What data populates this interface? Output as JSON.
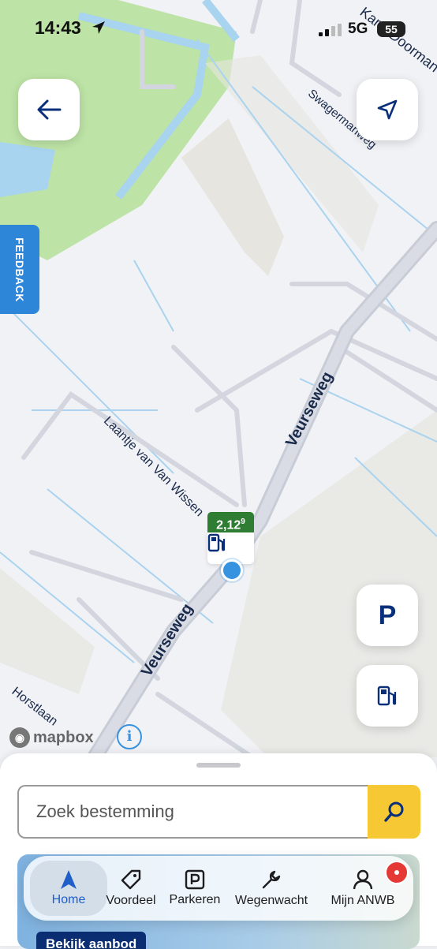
{
  "status_bar": {
    "time": "14:43",
    "network": "5G",
    "battery": "55"
  },
  "map": {
    "streets": [
      "Veurseweg",
      "Veurseweg",
      "Laantje van Van Wissen",
      "Swagermanweg",
      "Karel Doorman",
      "Horstlaan"
    ],
    "fuel_price": {
      "main": "2,12",
      "decimal": "9"
    },
    "attribution": "mapbox",
    "feedback_label": "FEEDBACK"
  },
  "search": {
    "placeholder": "Zoek bestemming"
  },
  "promo": {
    "button_label": "Bekijk aanbod"
  },
  "tabs": [
    {
      "label": "Home",
      "icon": "navigation-arrow-icon",
      "active": true
    },
    {
      "label": "Voordeel",
      "icon": "tag-icon"
    },
    {
      "label": "Parkeren",
      "icon": "parking-icon"
    },
    {
      "label": "Wegenwacht",
      "icon": "wrench-icon"
    },
    {
      "label": "Mijn ANWB",
      "icon": "person-icon"
    }
  ],
  "colors": {
    "accent_blue": "#1f5fc7",
    "anwb_yellow": "#f5c834",
    "price_green": "#2e7d32",
    "feedback_blue": "#2e86d9",
    "notification_red": "#e53935"
  }
}
